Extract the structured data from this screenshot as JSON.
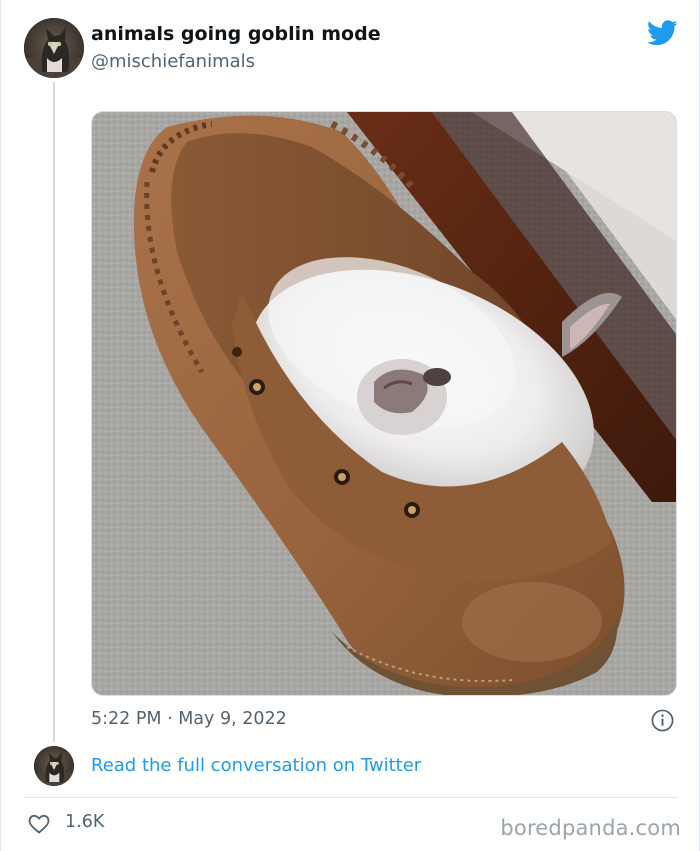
{
  "tweet": {
    "display_name": "animals going goblin mode",
    "handle": "@mischiefanimals",
    "timestamp": "5:22 PM · May 9, 2022",
    "like_count": "1.6K",
    "read_link_label": "Read the full conversation on Twitter"
  },
  "media": {
    "alt": "white kitten curled up asleep inside a brown suede moccasin on a gray carpet"
  },
  "watermark": "boredpanda.com",
  "icons": {
    "brand": "twitter-bird-icon",
    "info": "info-icon",
    "like": "heart-icon"
  },
  "colors": {
    "link": "#1d9bf0",
    "brand": "#1d9bf0",
    "secondary_text": "#536471",
    "primary_text": "#0f1419"
  }
}
